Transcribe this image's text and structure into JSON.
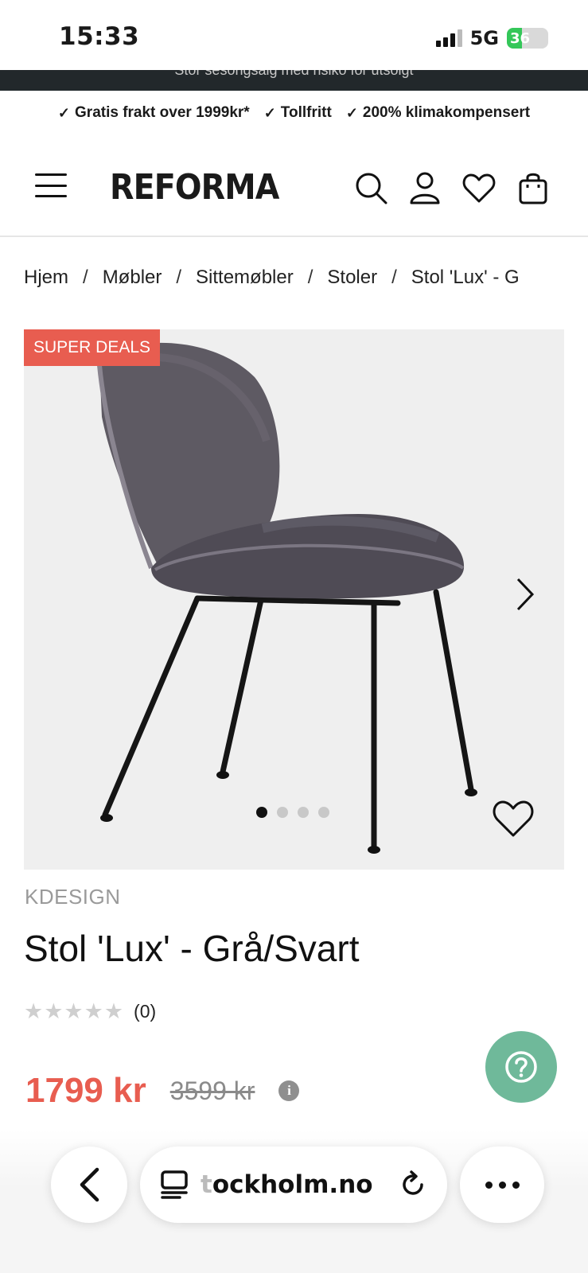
{
  "status_bar": {
    "time": "15:33",
    "network": "5G",
    "battery": "36",
    "battery_level": 0.36
  },
  "promo": {
    "text": "Stor sesongsalg med risiko for utsolgt"
  },
  "usps": [
    "Gratis frakt over 1999kr*",
    "Tollfritt",
    "200% klimakompensert"
  ],
  "header": {
    "logo": "REFORMA",
    "icons": [
      "menu-icon",
      "search-icon",
      "account-icon",
      "wishlist-icon",
      "cart-icon"
    ]
  },
  "breadcrumb": [
    "Hjem",
    "Møbler",
    "Sittemøbler",
    "Stoler",
    "Stol 'Lux' - G"
  ],
  "gallery": {
    "badge": "SUPER DEALS",
    "image_count": 4,
    "active_index": 0
  },
  "product": {
    "brand": "KDESIGN",
    "title": "Stol 'Lux' - Grå/Svart",
    "stars": "★★★★★",
    "rating": 0,
    "reviews": "(0)",
    "price": "1799 kr",
    "old_price": "3599 kr"
  },
  "colors": {
    "accent": "#e85d50",
    "help": "#6fb99a",
    "promo_bg": "#22282b"
  },
  "browser": {
    "url": "ockholm.no",
    "url_prefix": "t"
  }
}
